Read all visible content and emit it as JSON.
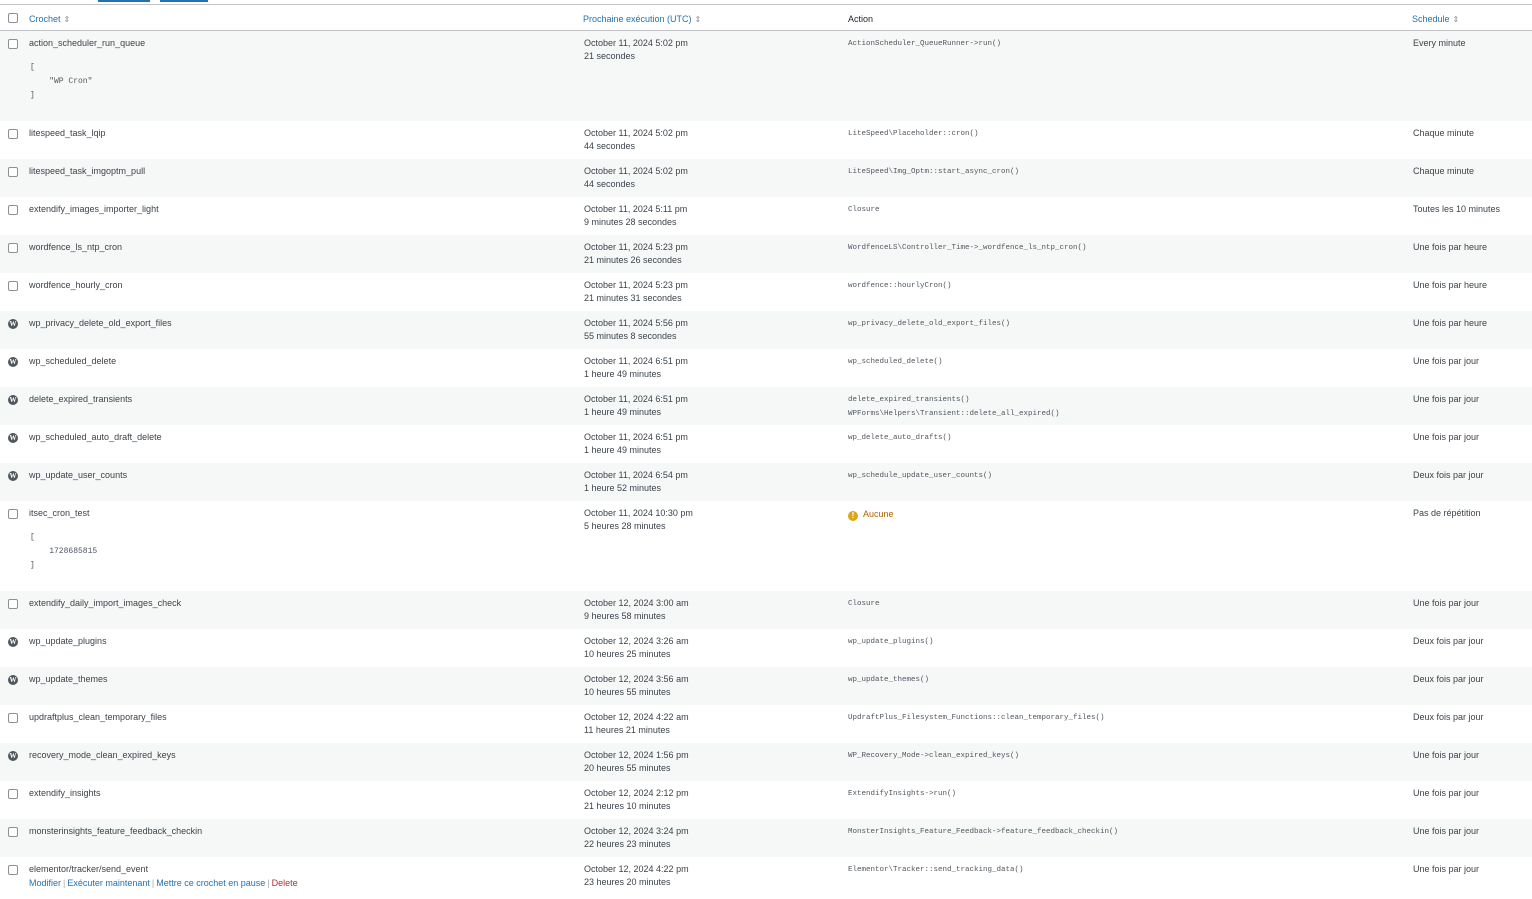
{
  "table": {
    "columns": {
      "hook": "Crochet",
      "next": "Prochaine exécution (UTC)",
      "action": "Action",
      "schedule": "Schedule"
    },
    "rows": [
      {
        "hook": "action_scheduler_run_queue",
        "icon": "checkbox",
        "args": "[\n    \"WP Cron\"\n]",
        "next_date": "October 11, 2024 5:02 pm",
        "next_rel": "21 secondes",
        "actions": [
          "ActionScheduler_QueueRunner->run()"
        ],
        "schedule": "Every minute"
      },
      {
        "hook": "litespeed_task_lqip",
        "icon": "checkbox",
        "next_date": "October 11, 2024 5:02 pm",
        "next_rel": "44 secondes",
        "actions": [
          "LiteSpeed\\Placeholder::cron()"
        ],
        "schedule": "Chaque minute"
      },
      {
        "hook": "litespeed_task_imgoptm_pull",
        "icon": "checkbox",
        "next_date": "October 11, 2024 5:02 pm",
        "next_rel": "44 secondes",
        "actions": [
          "LiteSpeed\\Img_Optm::start_async_cron()"
        ],
        "schedule": "Chaque minute"
      },
      {
        "hook": "extendify_images_importer_light",
        "icon": "checkbox",
        "next_date": "October 11, 2024 5:11 pm",
        "next_rel": "9 minutes 28 secondes",
        "actions": [
          "Closure"
        ],
        "schedule": "Toutes les 10 minutes"
      },
      {
        "hook": "wordfence_ls_ntp_cron",
        "icon": "checkbox",
        "next_date": "October 11, 2024 5:23 pm",
        "next_rel": "21 minutes 26 secondes",
        "actions": [
          "WordfenceLS\\Controller_Time->_wordfence_ls_ntp_cron()"
        ],
        "schedule": "Une fois par heure"
      },
      {
        "hook": "wordfence_hourly_cron",
        "icon": "checkbox",
        "next_date": "October 11, 2024 5:23 pm",
        "next_rel": "21 minutes 31 secondes",
        "actions": [
          "wordfence::hourlyCron()"
        ],
        "schedule": "Une fois par heure"
      },
      {
        "hook": "wp_privacy_delete_old_export_files",
        "icon": "wordpress",
        "next_date": "October 11, 2024 5:56 pm",
        "next_rel": "55 minutes 8 secondes",
        "actions": [
          "wp_privacy_delete_old_export_files()"
        ],
        "schedule": "Une fois par heure"
      },
      {
        "hook": "wp_scheduled_delete",
        "icon": "wordpress",
        "next_date": "October 11, 2024 6:51 pm",
        "next_rel": "1 heure 49 minutes",
        "actions": [
          "wp_scheduled_delete()"
        ],
        "schedule": "Une fois par jour"
      },
      {
        "hook": "delete_expired_transients",
        "icon": "wordpress",
        "next_date": "October 11, 2024 6:51 pm",
        "next_rel": "1 heure 49 minutes",
        "actions": [
          "delete_expired_transients()",
          "WPForms\\Helpers\\Transient::delete_all_expired()"
        ],
        "schedule": "Une fois par jour"
      },
      {
        "hook": "wp_scheduled_auto_draft_delete",
        "icon": "wordpress",
        "next_date": "October 11, 2024 6:51 pm",
        "next_rel": "1 heure 49 minutes",
        "actions": [
          "wp_delete_auto_drafts()"
        ],
        "schedule": "Une fois par jour"
      },
      {
        "hook": "wp_update_user_counts",
        "icon": "wordpress",
        "next_date": "October 11, 2024 6:54 pm",
        "next_rel": "1 heure 52 minutes",
        "actions": [
          "wp_schedule_update_user_counts()"
        ],
        "schedule": "Deux fois par jour"
      },
      {
        "hook": "itsec_cron_test",
        "icon": "checkbox",
        "args": "[\n    1728685815\n]",
        "next_date": "October 11, 2024 10:30 pm",
        "next_rel": "5 heures 28 minutes",
        "warning": "Aucune",
        "schedule": "Pas de répétition"
      },
      {
        "hook": "extendify_daily_import_images_check",
        "icon": "checkbox",
        "next_date": "October 12, 2024 3:00 am",
        "next_rel": "9 heures 58 minutes",
        "actions": [
          "Closure"
        ],
        "schedule": "Une fois par jour"
      },
      {
        "hook": "wp_update_plugins",
        "icon": "wordpress",
        "next_date": "October 12, 2024 3:26 am",
        "next_rel": "10 heures 25 minutes",
        "actions": [
          "wp_update_plugins()"
        ],
        "schedule": "Deux fois par jour"
      },
      {
        "hook": "wp_update_themes",
        "icon": "wordpress",
        "next_date": "October 12, 2024 3:56 am",
        "next_rel": "10 heures 55 minutes",
        "actions": [
          "wp_update_themes()"
        ],
        "schedule": "Deux fois par jour"
      },
      {
        "hook": "updraftplus_clean_temporary_files",
        "icon": "checkbox",
        "next_date": "October 12, 2024 4:22 am",
        "next_rel": "11 heures 21 minutes",
        "actions": [
          "UpdraftPlus_Filesystem_Functions::clean_temporary_files()"
        ],
        "schedule": "Deux fois par jour"
      },
      {
        "hook": "recovery_mode_clean_expired_keys",
        "icon": "wordpress",
        "next_date": "October 12, 2024 1:56 pm",
        "next_rel": "20 heures 55 minutes",
        "actions": [
          "WP_Recovery_Mode->clean_expired_keys()"
        ],
        "schedule": "Une fois par jour"
      },
      {
        "hook": "extendify_insights",
        "icon": "checkbox",
        "next_date": "October 12, 2024 2:12 pm",
        "next_rel": "21 heures 10 minutes",
        "actions": [
          "ExtendifyInsights->run()"
        ],
        "schedule": "Une fois par jour"
      },
      {
        "hook": "monsterinsights_feature_feedback_checkin",
        "icon": "checkbox",
        "next_date": "October 12, 2024 3:24 pm",
        "next_rel": "22 heures 23 minutes",
        "actions": [
          "MonsterInsights_Feature_Feedback->feature_feedback_checkin()"
        ],
        "schedule": "Une fois par jour"
      },
      {
        "hook": "elementor/tracker/send_event",
        "icon": "checkbox",
        "next_date": "October 12, 2024 4:22 pm",
        "next_rel": "23 heures 20 minutes",
        "actions": [
          "Elementor\\Tracker::send_tracking_data()"
        ],
        "schedule": "Une fois par jour",
        "row_actions": true
      }
    ]
  },
  "row_actions": {
    "edit": "Modifier",
    "run_now": "Exécuter maintenant",
    "pause": "Mettre ce crochet en pause",
    "delete": "Delete"
  },
  "colors": {
    "link": "#2271b1",
    "delete": "#b32d2e",
    "warning": "#dba617",
    "alt_row": "#f6f7f7"
  }
}
